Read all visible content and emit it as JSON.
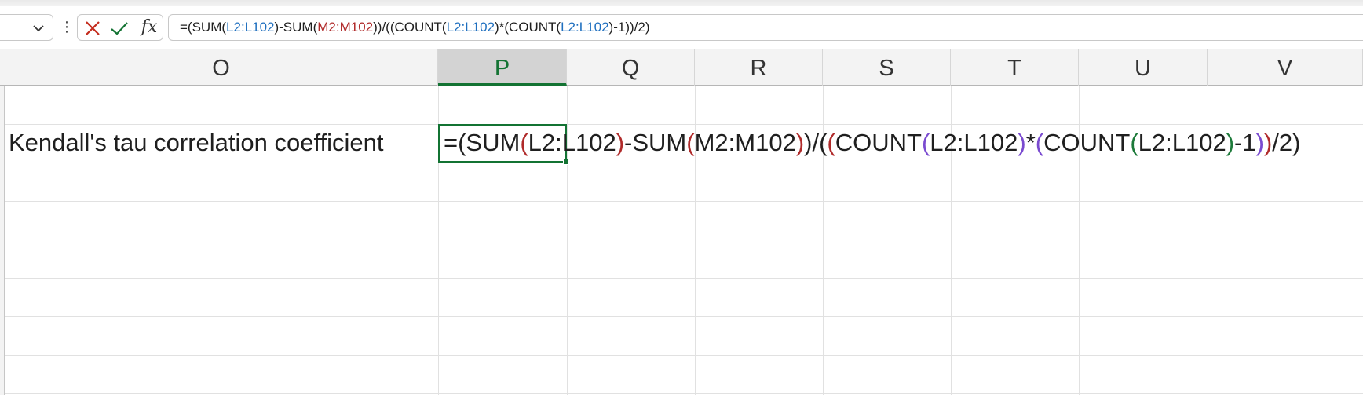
{
  "formula_bar": {
    "namebox_chevron_icon": "chevron-down-icon",
    "more_icon": "⋮",
    "cancel_icon": "close-icon",
    "enter_icon": "check-icon",
    "fx_label": "fx",
    "formula_tokens": [
      {
        "t": "=(SUM(",
        "c": ""
      },
      {
        "t": "L2:L102",
        "c": "blue"
      },
      {
        "t": ")-SUM(",
        "c": ""
      },
      {
        "t": "M2:M102",
        "c": "red"
      },
      {
        "t": "))/((COUNT(",
        "c": ""
      },
      {
        "t": "L2:L102",
        "c": "blue"
      },
      {
        "t": ")*(COUNT(",
        "c": ""
      },
      {
        "t": "L2:L102",
        "c": "blue"
      },
      {
        "t": ")-1))/2)",
        "c": ""
      }
    ]
  },
  "columns": [
    "O",
    "P",
    "Q",
    "R",
    "S",
    "T",
    "U",
    "V"
  ],
  "selected_column": "P",
  "cells": {
    "O3": "Kendall's tau correlation coefficient"
  },
  "edit_tokens": [
    {
      "t": "=(SUM",
      "c": ""
    },
    {
      "t": "(",
      "c": "red"
    },
    {
      "t": "L2:L102",
      "c": ""
    },
    {
      "t": ")",
      "c": "red"
    },
    {
      "t": "-SUM",
      "c": ""
    },
    {
      "t": "(",
      "c": "red"
    },
    {
      "t": "M2:M102",
      "c": ""
    },
    {
      "t": ")",
      "c": "red"
    },
    {
      "t": ")/(",
      "c": ""
    },
    {
      "t": "(",
      "c": "red"
    },
    {
      "t": "COUNT",
      "c": ""
    },
    {
      "t": "(",
      "c": "purple"
    },
    {
      "t": "L2:L102",
      "c": ""
    },
    {
      "t": ")",
      "c": "purple"
    },
    {
      "t": "*",
      "c": ""
    },
    {
      "t": "(",
      "c": "purple"
    },
    {
      "t": "COUNT",
      "c": ""
    },
    {
      "t": "(",
      "c": "green"
    },
    {
      "t": "L2:L102",
      "c": ""
    },
    {
      "t": ")",
      "c": "green"
    },
    {
      "t": "-1",
      "c": ""
    },
    {
      "t": ")",
      "c": "purple"
    },
    {
      "t": ")",
      "c": "red"
    },
    {
      "t": "/2)",
      "c": ""
    }
  ],
  "colors": {
    "accent_green": "#137333",
    "ref_blue": "#1f6fbf",
    "ref_red": "#b02a2a",
    "ref_green": "#1d7a3a",
    "ref_purple": "#7a4bd0"
  }
}
